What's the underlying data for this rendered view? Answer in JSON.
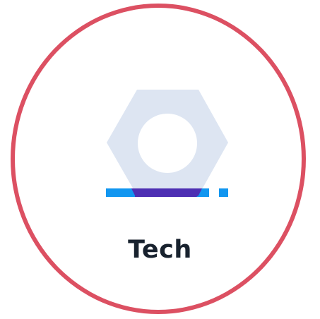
{
  "badge": {
    "label": "Tech",
    "icon": "hex-nut-icon",
    "colors": {
      "ring": "#dc5062",
      "nut": "#dde5f2",
      "bar": "#1196f0",
      "bar_overlap": "#4d2fb3",
      "text": "#18222e"
    }
  }
}
